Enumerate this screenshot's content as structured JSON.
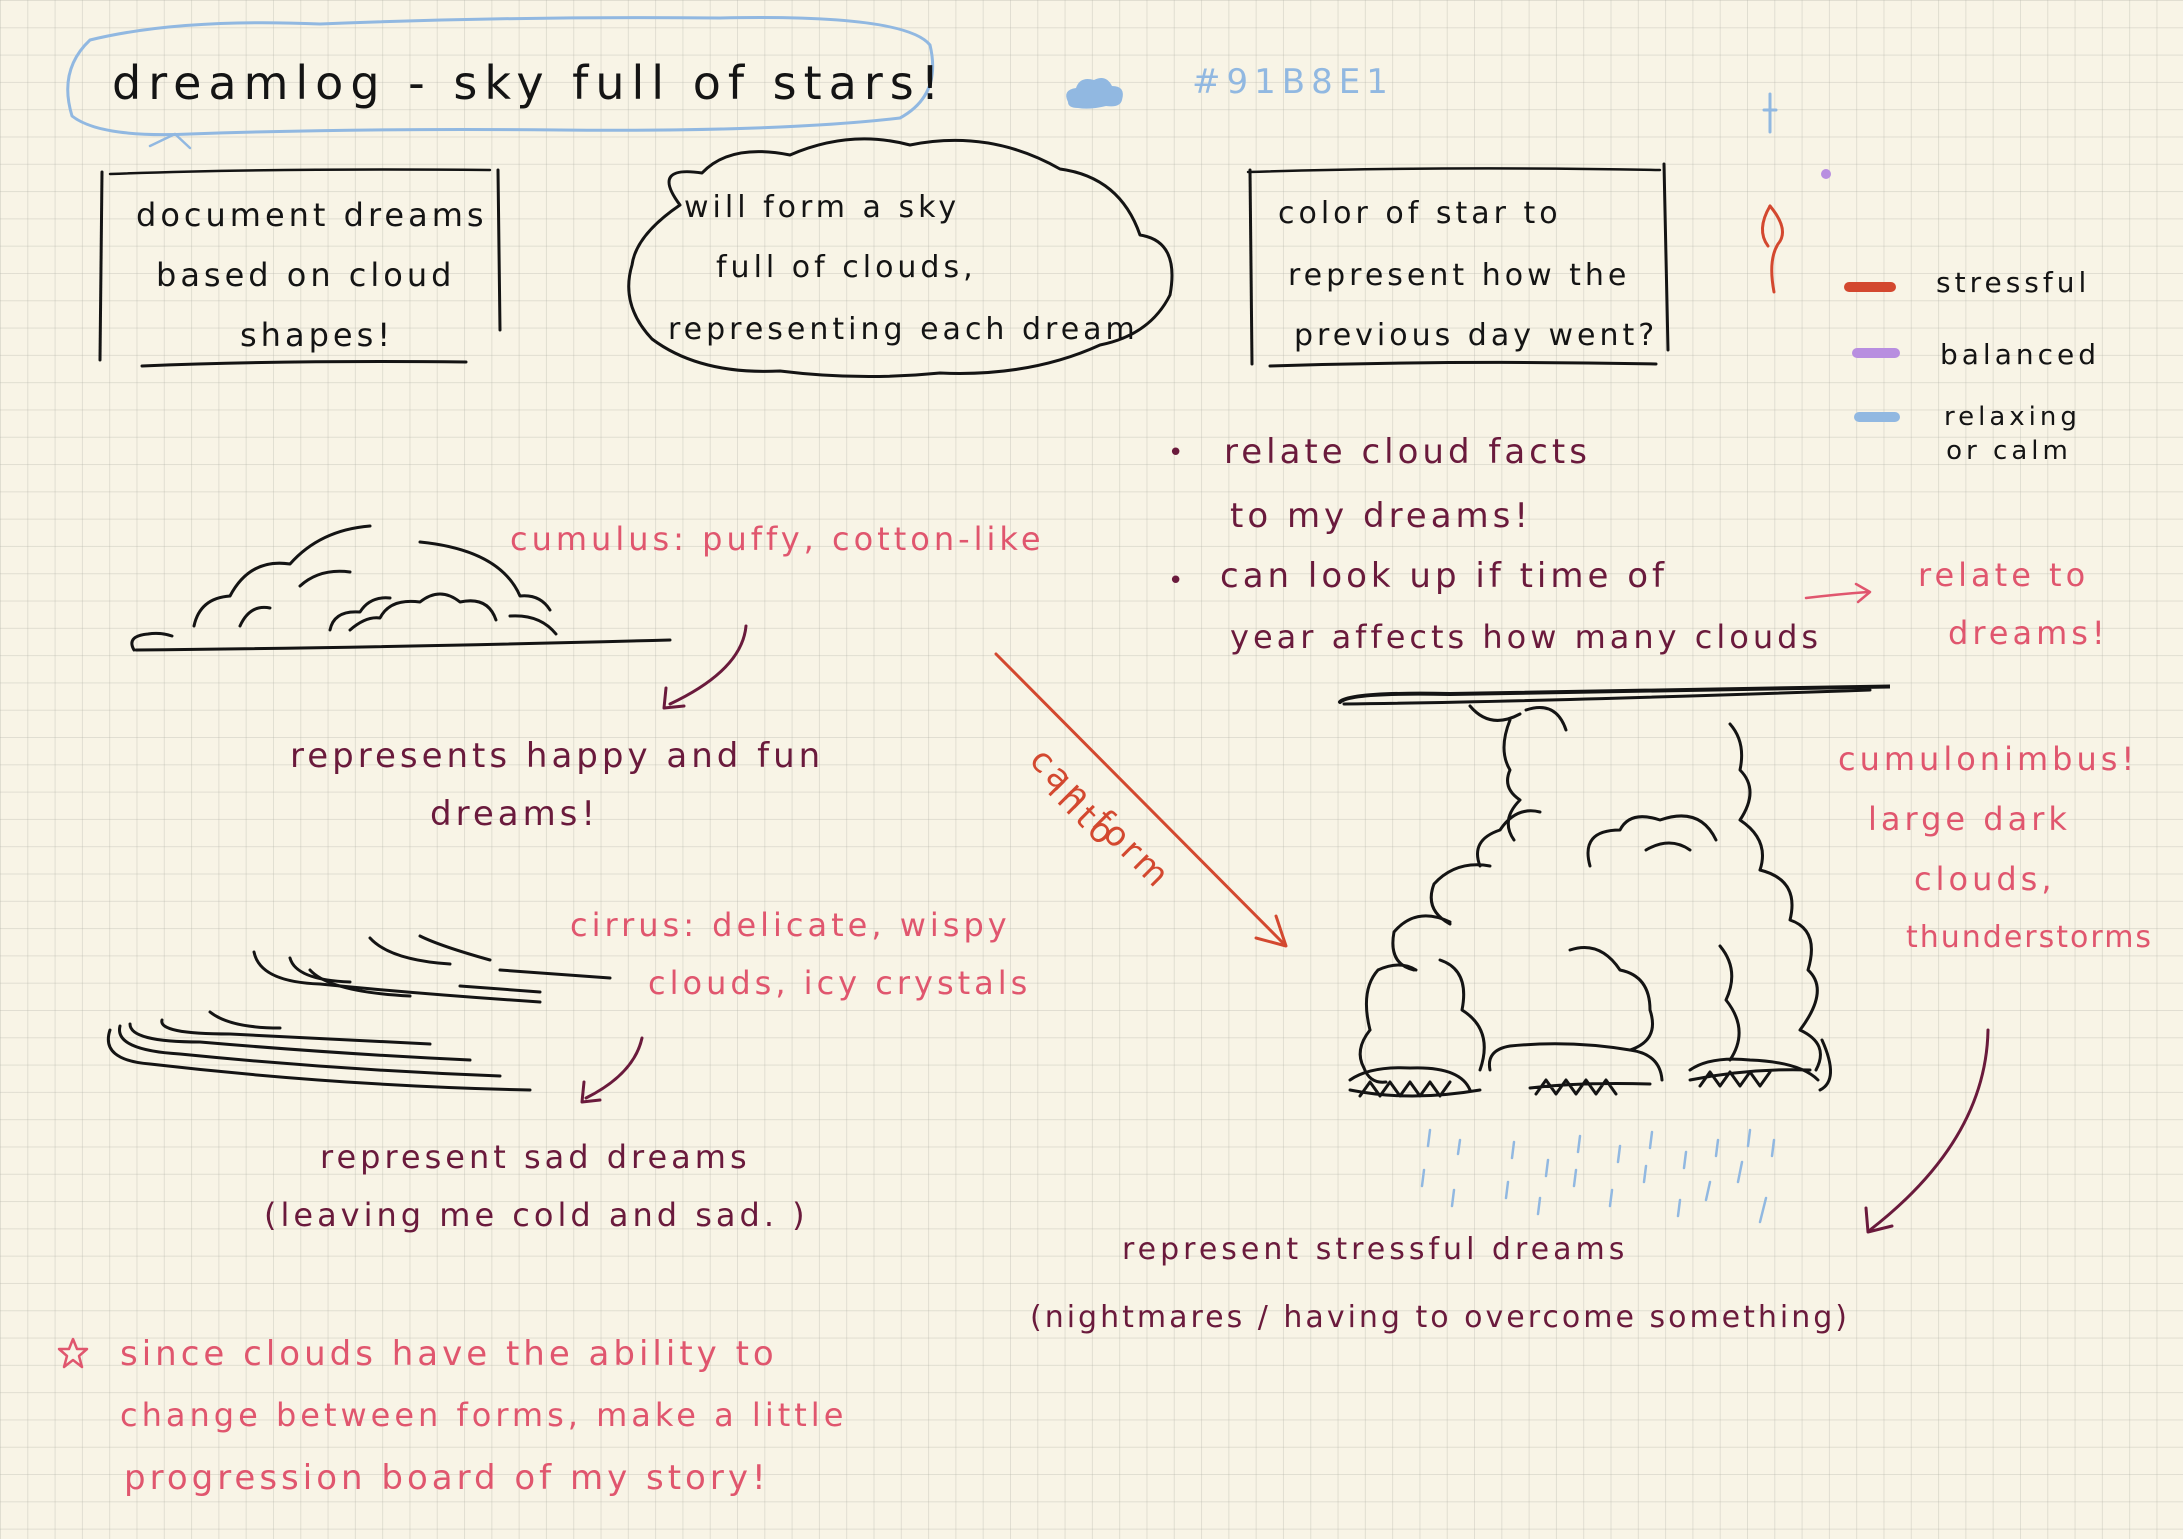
{
  "title": "dreamlog - sky full of stars!",
  "swatch": {
    "hex_label": "#91B8E1",
    "color": "#91B8E1"
  },
  "boxes": {
    "left": [
      "document dreams",
      "based on cloud",
      "shapes!"
    ],
    "middle": [
      "will form a sky",
      "full of clouds,",
      "representing each dream"
    ],
    "right": [
      "color of star to",
      "represent how the",
      "previous day went?"
    ]
  },
  "legend": [
    {
      "label": "stressful",
      "color": "#d3482f"
    },
    {
      "label": "balanced",
      "color": "#b88ee0"
    },
    {
      "label": "relaxing or calm",
      "color": "#91b8e1"
    }
  ],
  "notes": {
    "bullet1": [
      "relate cloud facts",
      "to my dreams!"
    ],
    "bullet2": [
      "can look up if time of",
      "year affects how many clouds"
    ],
    "relate": [
      "relate to",
      "dreams!"
    ]
  },
  "cumulus": {
    "label": "cumulus: puffy, cotton-like",
    "meaning": [
      "represents happy and fun",
      "dreams!"
    ]
  },
  "transition": {
    "line1": "can form",
    "line2": "into"
  },
  "cirrus": {
    "label": [
      "cirrus: delicate, wispy",
      "clouds, icy crystals"
    ],
    "meaning": [
      "represent sad dreams",
      "(leaving me cold and sad. )"
    ]
  },
  "cumulonimbus": {
    "label": [
      "cumulonimbus!",
      "large dark",
      "clouds,",
      "thunderstorms"
    ],
    "meaning": [
      "represent stressful dreams",
      "(nightmares / having to overcome something)"
    ]
  },
  "footnote": {
    "lines": [
      "since clouds have the ability to",
      "change between forms, make a little",
      "progression board of my story!"
    ]
  },
  "colors": {
    "ink": "#141414",
    "plum": "#6a1a3c",
    "pink": "#e0566e",
    "red": "#d3482f",
    "blue": "#91b8e1",
    "paper": "#f8f4e6"
  }
}
